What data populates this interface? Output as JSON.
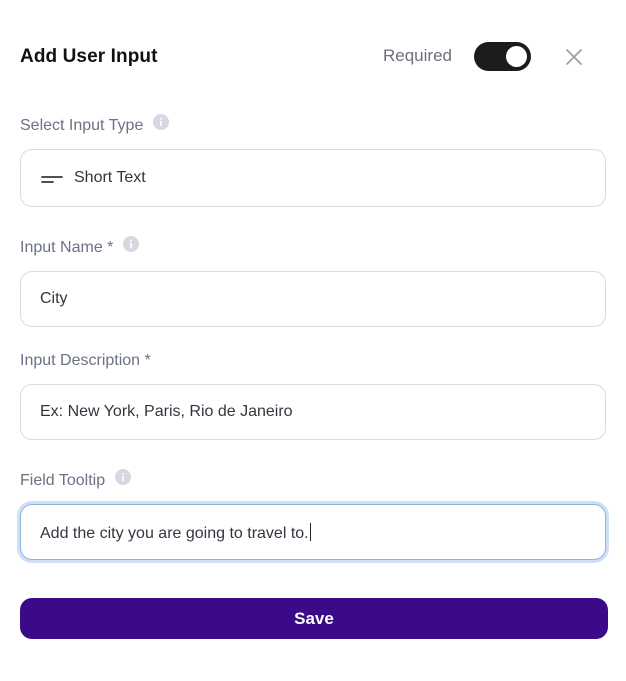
{
  "header": {
    "title": "Add User Input",
    "required_label": "Required",
    "required_on": true
  },
  "fields": {
    "input_type": {
      "label": "Select Input Type",
      "value": "Short Text",
      "icon": "short-text-icon"
    },
    "input_name": {
      "label": "Input Name *",
      "value": "City"
    },
    "input_description": {
      "label": "Input Description *",
      "value": "Ex: New York, Paris, Rio de Janeiro"
    },
    "field_tooltip": {
      "label": "Field Tooltip",
      "value": "Add the city you are going to travel to."
    }
  },
  "actions": {
    "save_label": "Save"
  },
  "colors": {
    "primary": "#3a0a88",
    "toggle_on": "#1c1c1c",
    "label": "#6b7286",
    "border": "#d9dbe2",
    "focus_ring": "#cfe0f5"
  }
}
